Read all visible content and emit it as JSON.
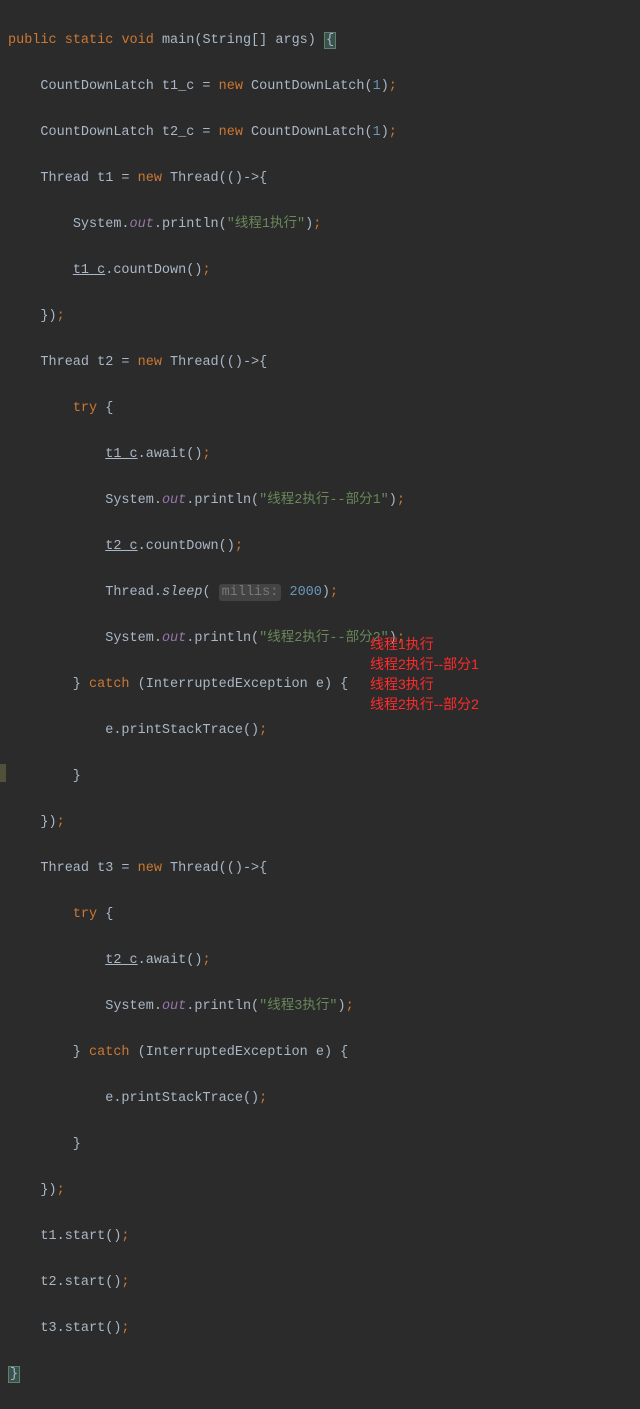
{
  "code": {
    "l1_public": "public",
    "l1_static": "static",
    "l1_void": "void",
    "l1_main": "main",
    "l1_type": "String",
    "l1_args": "[] args)",
    "l2_type": "CountDownLatch",
    "l2_var": " t1_c = ",
    "l2_new": "new",
    "l2_ctor": " CountDownLatch(",
    "l2_num": "1",
    "l3_var": " t2_c = ",
    "l4_type": "Thread",
    "l4_var": " t1 = ",
    "l4_ctor": " Thread(()->{",
    "l5_sys": "System.",
    "l5_out": "out",
    "l5_println": ".println(",
    "l5_str": "\"线程1执行\"",
    "l6_t1c": "t1_c",
    "l6_cd": ".countDown()",
    "l8_var": " t2 = ",
    "l9_try": "try",
    "l10_await": ".await()",
    "l11_str": "\"线程2执行--部分1\"",
    "l12_t2c": "t2_c",
    "l13_sleep": "sleep",
    "l13_hint": "millis:",
    "l13_num": " 2000",
    "l14_str": "\"线程2执行--部分2\"",
    "l15_catch": "catch",
    "l15_exc": " (InterruptedException e) {",
    "l16_pst": "e.printStackTrace()",
    "l19_var": " t3 = ",
    "l22_str": "\"线程3执行\"",
    "l26_start1": "t1.start()",
    "l27_start2": "t2.start()",
    "l28_start3": "t3.start()"
  },
  "output": {
    "line1": "线程1执行",
    "line2": "线程2执行--部分1",
    "line3": "线程3执行",
    "line4": "线程2执行--部分2"
  }
}
